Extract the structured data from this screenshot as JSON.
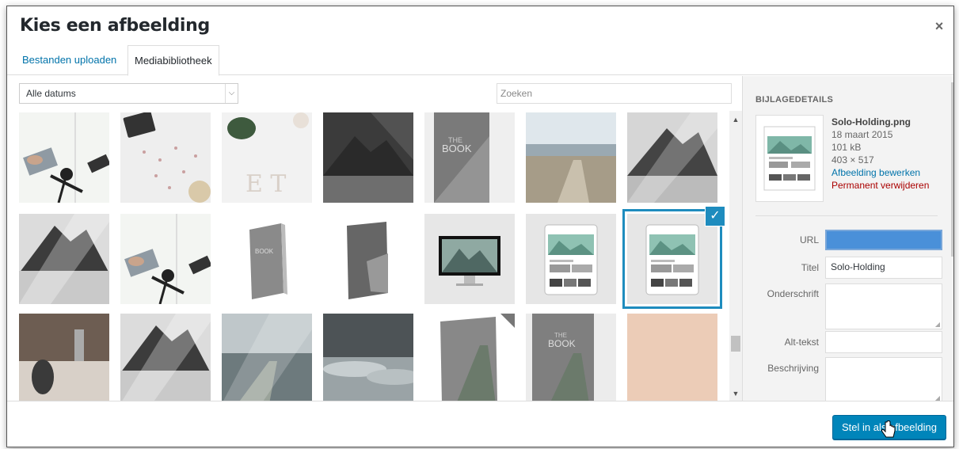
{
  "dialog": {
    "title": "Kies een afbeelding",
    "close_label": "×"
  },
  "tabs": [
    {
      "label": "Bestanden uploaden",
      "active": false
    },
    {
      "label": "Mediabibliotheek",
      "active": true
    }
  ],
  "toolbar": {
    "date_filter": "Alle datums",
    "search_placeholder": "Zoeken"
  },
  "grid": {
    "items": [
      {
        "theme": "desk-laptop"
      },
      {
        "theme": "tablet-confetti"
      },
      {
        "theme": "letters-plant"
      },
      {
        "theme": "dark-mountain"
      },
      {
        "theme": "book-cover"
      },
      {
        "theme": "beach-boardwalk"
      },
      {
        "theme": "grey-mountain"
      },
      {
        "theme": "grey-mountain-fog"
      },
      {
        "theme": "desk-laptop"
      },
      {
        "theme": "book-3d"
      },
      {
        "theme": "magazine-3d"
      },
      {
        "theme": "imac"
      },
      {
        "theme": "tablet-site"
      },
      {
        "theme": "tablet-site",
        "selected": true
      },
      {
        "theme": "cafe-phone"
      },
      {
        "theme": "grey-mountain-fog"
      },
      {
        "theme": "sea-fog"
      },
      {
        "theme": "clouds"
      },
      {
        "theme": "book-3d-boardwalk"
      },
      {
        "theme": "book-boardwalk"
      },
      {
        "theme": "peach"
      }
    ]
  },
  "details": {
    "heading": "BIJLAGEDETAILS",
    "filename": "Solo-Holding.png",
    "date": "18 maart 2015",
    "size": "101 kB",
    "dimensions": "403 × 517",
    "edit_link": "Afbeelding bewerken",
    "delete_link": "Permanent verwijderen",
    "fields": {
      "url_label": "URL",
      "url_value": "",
      "title_label": "Titel",
      "title_value": "Solo-Holding",
      "caption_label": "Onderschrift",
      "alt_label": "Alt-tekst",
      "description_label": "Beschrijving"
    }
  },
  "footer": {
    "primary_label": "Stel in als afbeelding"
  },
  "colors": {
    "accent": "#0085ba",
    "link": "#0073aa",
    "danger": "#a00000",
    "selection": "#1e8cbe"
  }
}
